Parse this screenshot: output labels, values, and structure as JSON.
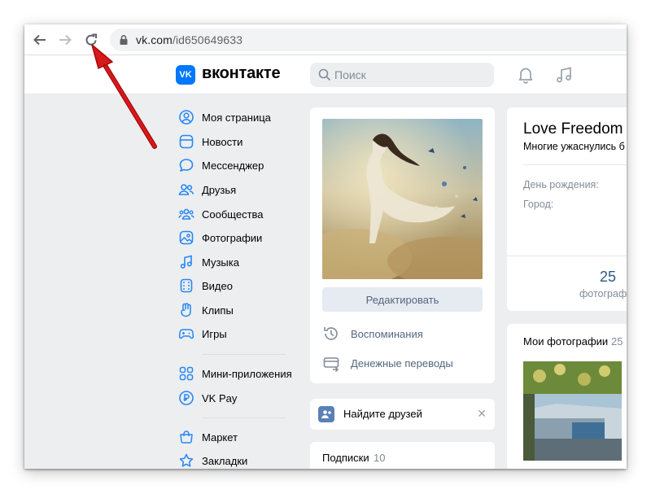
{
  "browser": {
    "url_domain": "vk.com",
    "url_path": "/id650649633"
  },
  "header": {
    "logo_text": "VK",
    "brand": "вконтакте",
    "search_placeholder": "Поиск"
  },
  "sidebar": {
    "items": [
      {
        "label": "Моя страница",
        "icon": "user-circle-icon"
      },
      {
        "label": "Новости",
        "icon": "news-icon"
      },
      {
        "label": "Мессенджер",
        "icon": "message-icon"
      },
      {
        "label": "Друзья",
        "icon": "friends-icon"
      },
      {
        "label": "Сообщества",
        "icon": "communities-icon"
      },
      {
        "label": "Фотографии",
        "icon": "photo-icon"
      },
      {
        "label": "Музыка",
        "icon": "music-icon"
      },
      {
        "label": "Видео",
        "icon": "video-icon"
      },
      {
        "label": "Клипы",
        "icon": "clips-icon"
      },
      {
        "label": "Игры",
        "icon": "gamepad-icon"
      },
      {
        "label": "Мини-приложения",
        "icon": "mini-apps-icon"
      },
      {
        "label": "VK Pay",
        "icon": "vk-pay-icon"
      },
      {
        "label": "Маркет",
        "icon": "market-icon"
      },
      {
        "label": "Закладки",
        "icon": "star-icon"
      }
    ]
  },
  "profile": {
    "edit_label": "Редактировать",
    "memories_label": "Воспоминания",
    "transfers_label": "Денежные переводы",
    "find_friends_label": "Найдите друзей",
    "close_glyph": "✕",
    "subscriptions_label": "Подписки",
    "subscriptions_count": "10",
    "name": "Love Freedom",
    "status": "Многие ужаснулись б",
    "birthday_label": "День рождения:",
    "city_label": "Город:",
    "photos_stat_count": "25",
    "photos_stat_label": "фотограф",
    "my_photos_title": "Мои фотографии",
    "my_photos_count": "25"
  },
  "colors": {
    "vk_blue": "#0077ff",
    "link": "#2a5885",
    "muted": "#818c99",
    "annotation_red": "#d7191c"
  }
}
